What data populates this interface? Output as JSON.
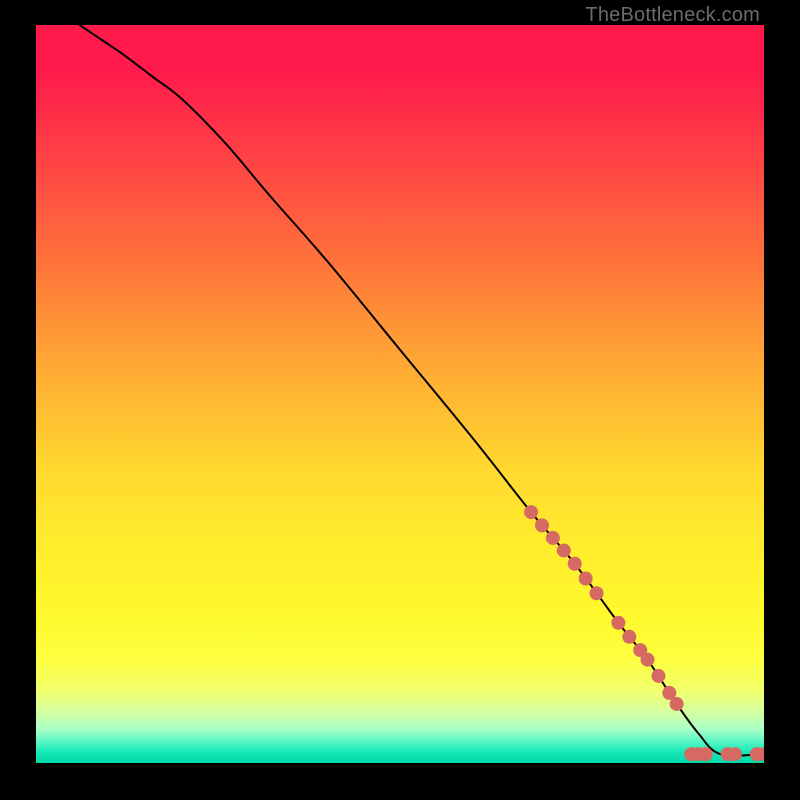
{
  "attribution": "TheBottleneck.com",
  "chart_data": {
    "type": "line",
    "title": "",
    "xlabel": "",
    "ylabel": "",
    "xlim": [
      0,
      100
    ],
    "ylim": [
      0,
      100
    ],
    "curve": {
      "name": "main-curve",
      "x": [
        6,
        9,
        12,
        16,
        20,
        26,
        32,
        40,
        50,
        60,
        68,
        74,
        80,
        84,
        88,
        91,
        94,
        100
      ],
      "y": [
        100,
        98,
        96,
        93,
        90,
        84,
        77,
        68,
        56,
        44,
        34,
        27,
        19,
        14,
        8,
        4,
        1.2,
        1.2
      ]
    },
    "markers": {
      "name": "data-points",
      "color": "#d66a62",
      "radius": 7,
      "points": [
        {
          "x": 68,
          "y": 34,
          "on_curve": true
        },
        {
          "x": 69.5,
          "y": 32.2,
          "on_curve": true
        },
        {
          "x": 71,
          "y": 30.5,
          "on_curve": true
        },
        {
          "x": 72.5,
          "y": 28.8,
          "on_curve": true
        },
        {
          "x": 74,
          "y": 27,
          "on_curve": true
        },
        {
          "x": 75.5,
          "y": 25,
          "on_curve": true
        },
        {
          "x": 77,
          "y": 23,
          "on_curve": true
        },
        {
          "x": 80,
          "y": 19,
          "on_curve": true
        },
        {
          "x": 81.5,
          "y": 17.1,
          "on_curve": true
        },
        {
          "x": 83,
          "y": 15.3,
          "on_curve": true
        },
        {
          "x": 84,
          "y": 14,
          "on_curve": true
        },
        {
          "x": 85.5,
          "y": 11.8,
          "on_curve": true
        },
        {
          "x": 87,
          "y": 9.5,
          "on_curve": true
        },
        {
          "x": 88,
          "y": 8,
          "on_curve": true
        },
        {
          "x": 90,
          "y": 1.2,
          "on_curve": true
        },
        {
          "x": 91,
          "y": 1.2,
          "on_curve": true
        },
        {
          "x": 92,
          "y": 1.2,
          "on_curve": true
        },
        {
          "x": 95,
          "y": 1.2,
          "on_curve": true
        },
        {
          "x": 96,
          "y": 1.2,
          "on_curve": true
        },
        {
          "x": 99,
          "y": 1.2,
          "on_curve": true
        },
        {
          "x": 100,
          "y": 1.2,
          "on_curve": true
        }
      ]
    }
  }
}
